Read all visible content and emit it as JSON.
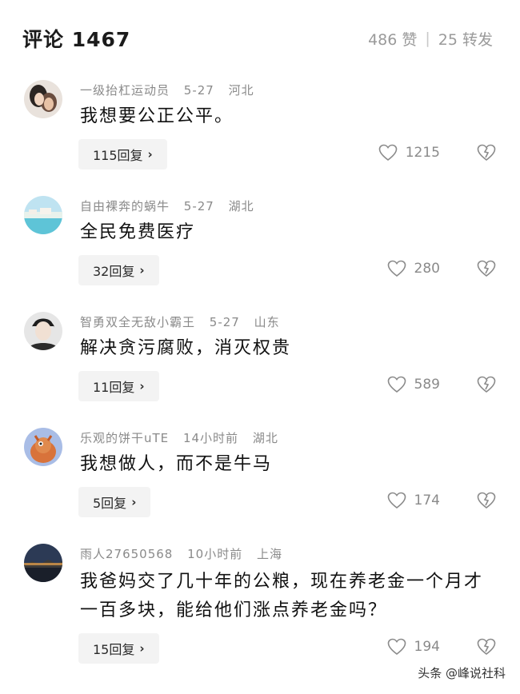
{
  "header": {
    "title": "评论 1467",
    "likes": "486 赞",
    "separator": "|",
    "shares": "25 转发"
  },
  "comments": [
    {
      "username": "一级抬杠运动员",
      "date": "5-27",
      "location": "河北",
      "text": "我想要公正公平。",
      "replies": "115回复",
      "likes": "1215"
    },
    {
      "username": "自由裸奔的蜗牛",
      "date": "5-27",
      "location": "湖北",
      "text": "全民免费医疗",
      "replies": "32回复",
      "likes": "280"
    },
    {
      "username": "智勇双全无敌小霸王",
      "date": "5-27",
      "location": "山东",
      "text": "解决贪污腐败，消灭权贵",
      "replies": "11回复",
      "likes": "589"
    },
    {
      "username": "乐观的饼干uTE",
      "date": "14小时前",
      "location": "湖北",
      "text": "我想做人，而不是牛马",
      "replies": "5回复",
      "likes": "174"
    },
    {
      "username": "雨人27650568",
      "date": "10小时前",
      "location": "上海",
      "text": "我爸妈交了几十年的公粮，现在养老金一个月才一百多块，能给他们涨点养老金吗？",
      "replies": "15回复",
      "likes": "194"
    }
  ],
  "watermark": {
    "text": "头条 @峰说社科"
  },
  "icons": {
    "reply_chevron": "chevron-right-icon",
    "like": "heart-outline-icon",
    "dislike": "broken-heart-icon"
  }
}
